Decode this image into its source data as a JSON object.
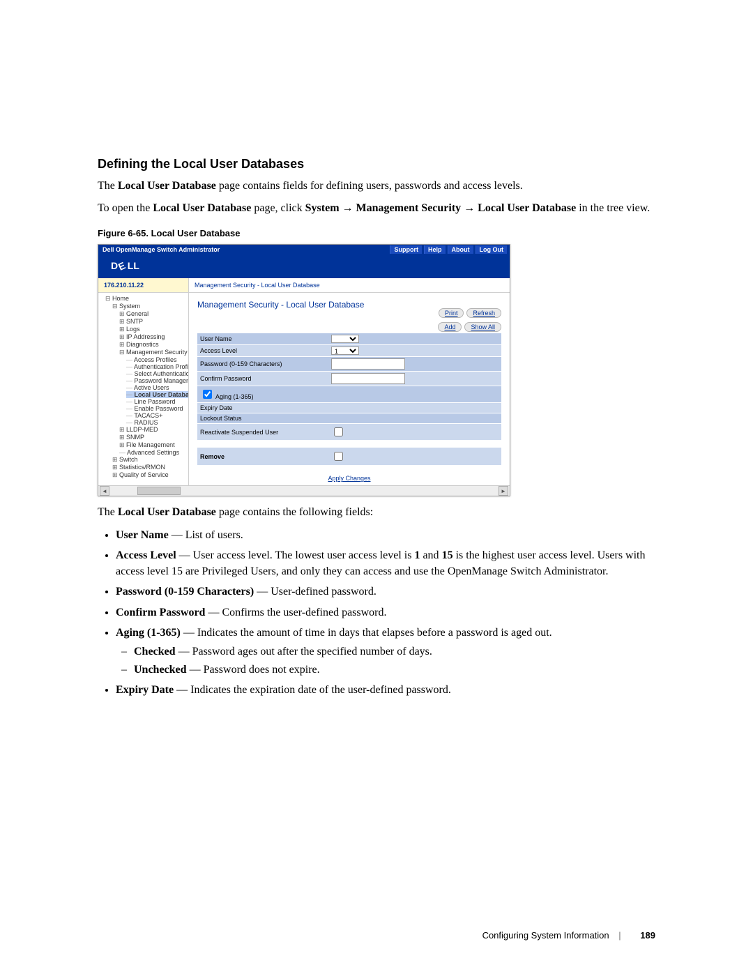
{
  "heading": "Defining the Local User Databases",
  "intro_before_bold": "The ",
  "intro_bold": "Local User Database",
  "intro_after_bold": " page contains fields for defining users, passwords and access levels.",
  "open_line": {
    "p1": "To open the ",
    "b1": "Local User Database",
    "p2": " page, click ",
    "b2": "System",
    "arrow1": " → ",
    "b3": "Management Security",
    "arrow2": " → ",
    "b4": "Local User Database",
    "p3": " in the tree view."
  },
  "figure_caption": "Figure 6-65.    Local User Database",
  "shot": {
    "top_title": "Dell OpenManage Switch Administrator",
    "top_links": [
      "Support",
      "Help",
      "About",
      "Log Out"
    ],
    "ip": "176.210.11.22",
    "crumbs": "Management Security - Local User Database",
    "content_title": "Management Security - Local User Database",
    "btns1": [
      "Print",
      "Refresh"
    ],
    "btns2": [
      "Add",
      "Show All"
    ],
    "tree": {
      "home": "Home",
      "system": "System",
      "children": [
        "General",
        "SNTP",
        "Logs",
        "IP Addressing",
        "Diagnostics"
      ],
      "mgmt_sec": "Management Security",
      "mgmt_children": [
        "Access Profiles",
        "Authentication Profil",
        "Select Authenticatio",
        "Password Managem",
        "Active Users"
      ],
      "selected": "Local User Databa",
      "mgmt_children2": [
        "Line Password",
        "Enable Password",
        "TACACS+",
        "RADIUS"
      ],
      "after": [
        "LLDP-MED",
        "SNMP",
        "File Management",
        "Advanced Settings"
      ],
      "top_after": [
        "Switch",
        "Statistics/RMON",
        "Quality of Service"
      ]
    },
    "form": {
      "user_name": "User Name",
      "access_level": "Access Level",
      "access_level_value": "1",
      "password": "Password (0-159 Characters)",
      "confirm": "Confirm Password",
      "aging_chk": "Aging (1-365)",
      "expiry": "Expiry Date",
      "lockout": "Lockout Status",
      "reactivate": "Reactivate Suspended User"
    },
    "remove": "Remove",
    "apply": "Apply Changes"
  },
  "fields_intro": {
    "p1": "The ",
    "b1": "Local User Database",
    "p2": " page contains the following fields:"
  },
  "bullets": [
    {
      "b": "User Name",
      "t": " — List of users."
    },
    {
      "b": "Access Level",
      "t": " — User access level. The lowest user access level is ",
      "b2": "1",
      "t2": " and ",
      "b3": "15",
      "t3": " is the highest user access level. Users with access level 15 are Privileged Users, and only they can access and use the OpenManage Switch Administrator."
    },
    {
      "b": "Password (0-159 Characters)",
      "t": " — User-defined password."
    },
    {
      "b": "Confirm Password",
      "t": " — Confirms the user-defined password."
    },
    {
      "b": "Aging (1-365)",
      "t": " — Indicates the amount of time in days that elapses before a password is aged out.",
      "sub": [
        {
          "b": "Checked",
          "t": " — Password ages out after the specified number of days."
        },
        {
          "b": "Unchecked",
          "t": " — Password does not expire."
        }
      ]
    },
    {
      "b": "Expiry Date",
      "t": " — Indicates the expiration date of the user-defined password."
    }
  ],
  "footer": {
    "section": "Configuring System Information",
    "page": "189"
  }
}
